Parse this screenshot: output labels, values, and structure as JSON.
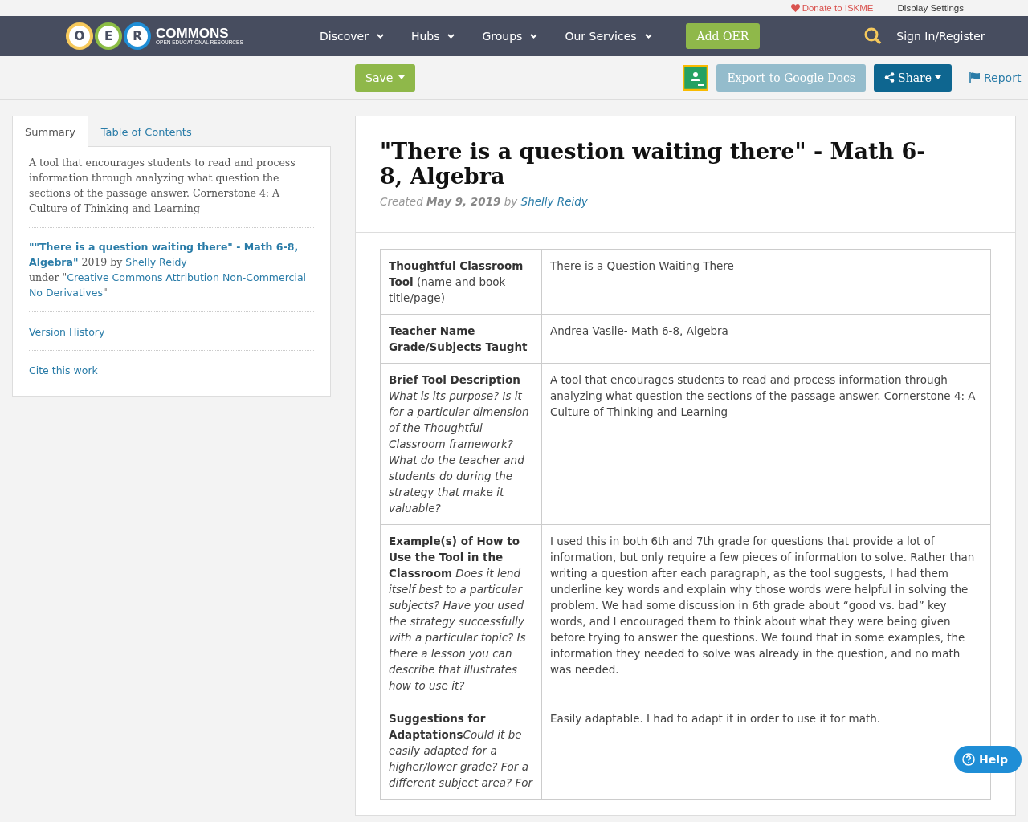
{
  "top_bar": {
    "donate": "Donate to ISKME",
    "display_settings": "Display Settings"
  },
  "nav": {
    "logo_letters": [
      "O",
      "E",
      "R"
    ],
    "logo_title": "COMMONS",
    "logo_subtitle": "OPEN EDUCATIONAL RESOURCES",
    "menu": [
      {
        "label": "Discover"
      },
      {
        "label": "Hubs"
      },
      {
        "label": "Groups"
      },
      {
        "label": "Our Services"
      }
    ],
    "add_button": "Add OER",
    "sign_in": "Sign In/Register"
  },
  "toolbar": {
    "save": "Save",
    "export": "Export to Google Docs",
    "share": "Share",
    "report": "Report"
  },
  "sidebar": {
    "tabs": [
      {
        "label": "Summary",
        "selected": true
      },
      {
        "label": "Table of Contents",
        "selected": false
      }
    ],
    "summary": "A tool that encourages students to read and process information through analyzing what question the sections of the passage answer. Cornerstone 4: A Culture of Thinking and Learning",
    "attribution": {
      "title": "\"\"There is a question waiting there\" - Math 6-8, Algebra\"",
      "year_by": "2019 by",
      "author": "Shelly Reidy",
      "under": "under \"",
      "license": "Creative Commons Attribution Non-Commercial No Derivatives",
      "close": "\""
    },
    "version_history": "Version History",
    "cite": "Cite this work"
  },
  "resource": {
    "title": "\"There is a question waiting there\" - Math 6-8, Algebra",
    "created": "Created",
    "date": "May 9, 2019",
    "by": "by",
    "author": "Shelly Reidy",
    "rows": [
      {
        "label": "Thoughtful Classroom Tool",
        "hint": " (name and book title/page)",
        "value": "There is a Question Waiting There"
      },
      {
        "label": "Teacher Name Grade/Subjects Taught",
        "value": "Andrea Vasile- Math 6-8, Algebra"
      },
      {
        "label": "Brief Tool Description",
        "hint": " *What is its purpose? Is it for a particular dimension of the Thoughtful Classroom framework? What do the teacher and students do during the strategy that make it valuable?*",
        "value": "A tool that encourages students to read and process information through analyzing what question the sections of the passage answer. Cornerstone 4: A Culture of Thinking and Learning"
      },
      {
        "label": "Example(s) of How to Use the Tool in the Classroom",
        "hint": " *Does it lend itself best to a particular subjects? Have you used the strategy successfully with a particular topic? Is there a lesson you can describe that illustrates how to use it?*",
        "value": "I used this in both 6th and 7th grade for questions that provide a lot of information, but only require a few pieces of information to solve. Rather than writing a question after each paragraph, as the tool suggests, I had them underline key words and explain why those words were helpful in solving the problem. We had some discussion in 6th grade about “good vs. bad” key words, and I encouraged them to think about what they were being given before trying to answer the questions. We found that in some examples, the information they needed to solve was already in the question, and no math was needed."
      },
      {
        "label": "Suggestions for Adaptations",
        "hint": "*Could it be easily adapted for a higher/lower grade? For a different subject area? For*",
        "value": "Easily adaptable. I had to adapt it in order to use it for math."
      }
    ]
  },
  "help": "Help"
}
